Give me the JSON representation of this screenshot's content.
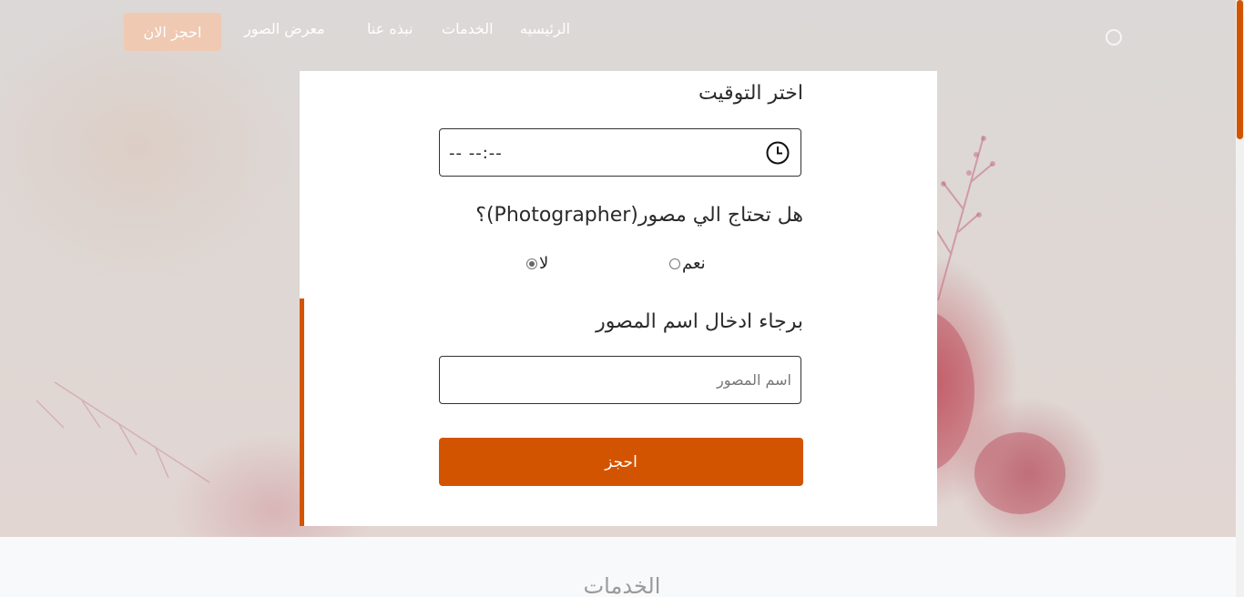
{
  "navbar": {
    "links": [
      {
        "label": "الرئيسيه"
      },
      {
        "label": "الخدمات"
      },
      {
        "label": "نبذه عنا"
      },
      {
        "label": "معرض الصور"
      }
    ],
    "book_now_label": "احجز الان"
  },
  "booking_form": {
    "time_label": "اختر التوقيت",
    "time_value": "-- --:--",
    "photographer_question": "هل تحتاج الي مصور(Photographer)؟",
    "options": [
      {
        "label": "نعم",
        "checked": false
      },
      {
        "label": "لا",
        "checked": true
      }
    ],
    "photographer_name_label": "برجاء ادخال اسم المصور",
    "photographer_name_placeholder": "اسم المصور",
    "photographer_name_value": "",
    "submit_label": "احجز"
  },
  "services_section": {
    "heading": "الخدمات"
  },
  "colors": {
    "accent": "#d35400",
    "book_now_bg": "#efc9b2",
    "card_bg": "#ffffff"
  },
  "icons": {
    "clock": "clock-icon",
    "radio": "radio-button"
  }
}
